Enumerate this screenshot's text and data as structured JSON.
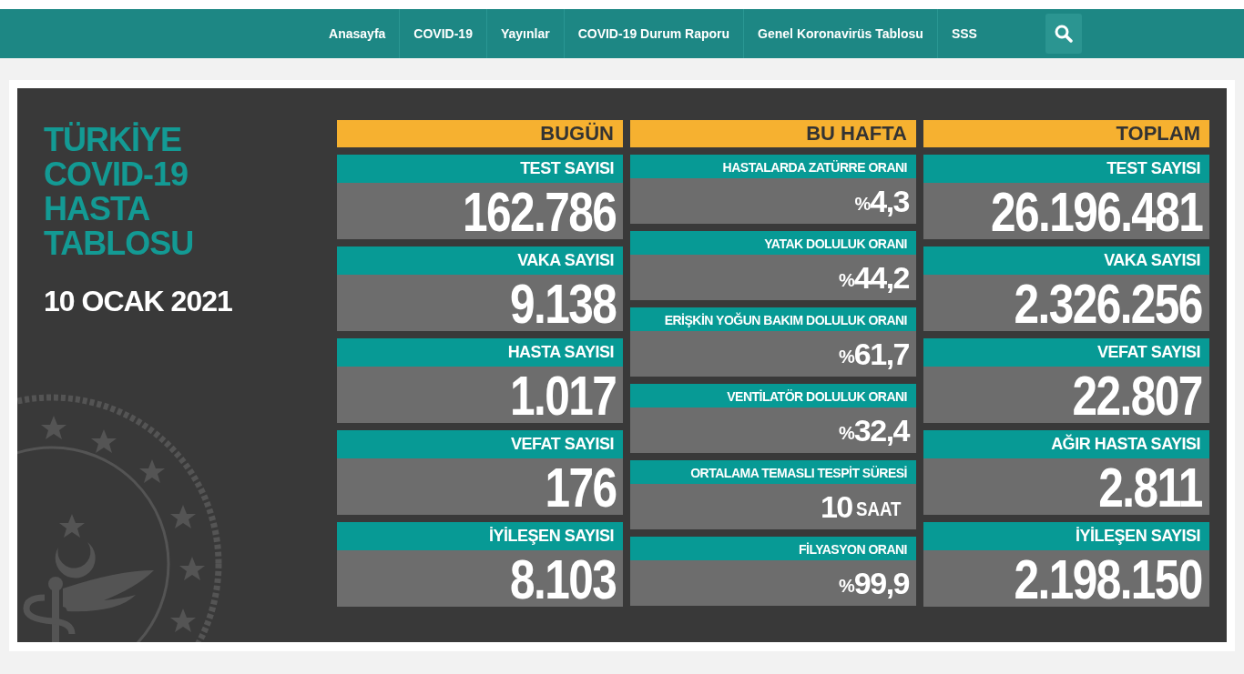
{
  "nav": {
    "items": [
      "Anasayfa",
      "COVID-19",
      "Yayınlar",
      "COVID-19 Durum Raporu",
      "Genel Koronavirüs Tablosu",
      "SSS"
    ]
  },
  "title": "TÜRKİYE COVID-19 HASTA TABLOSU",
  "date": "10 OCAK 2021",
  "columns": [
    {
      "header": "BUGÜN",
      "kind": "big",
      "cards": [
        {
          "label": "TEST SAYISI",
          "value": "162.786"
        },
        {
          "label": "VAKA SAYISI",
          "value": "9.138"
        },
        {
          "label": "HASTA SAYISI",
          "value": "1.017"
        },
        {
          "label": "VEFAT SAYISI",
          "value": "176"
        },
        {
          "label": "İYİLEŞEN SAYISI",
          "value": "8.103"
        }
      ]
    },
    {
      "header": "BU HAFTA",
      "kind": "small",
      "cards": [
        {
          "label": "HASTALARDA ZATÜRRE ORANI",
          "prefix": "%",
          "value": "4,3"
        },
        {
          "label": "YATAK DOLULUK ORANI",
          "prefix": "%",
          "value": "44,2"
        },
        {
          "label": "ERİŞKİN YOĞUN BAKIM DOLULUK ORANI",
          "prefix": "%",
          "value": "61,7"
        },
        {
          "label": "VENTİLATÖR DOLULUK ORANI",
          "prefix": "%",
          "value": "32,4"
        },
        {
          "label": "ORTALAMA TEMASLI TESPİT SÜRESİ",
          "value": "10",
          "unit": "SAAT"
        },
        {
          "label": "FİLYASYON ORANI",
          "prefix": "%",
          "value": "99,9"
        }
      ]
    },
    {
      "header": "TOPLAM",
      "kind": "big",
      "cards": [
        {
          "label": "TEST SAYISI",
          "value": "26.196.481"
        },
        {
          "label": "VAKA SAYISI",
          "value": "2.326.256"
        },
        {
          "label": "VEFAT SAYISI",
          "value": "22.807"
        },
        {
          "label": "AĞIR HASTA SAYISI",
          "value": "2.811"
        },
        {
          "label": "İYİLEŞEN SAYISI",
          "value": "2.198.150"
        }
      ]
    }
  ]
}
